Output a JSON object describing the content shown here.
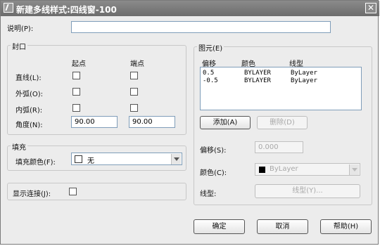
{
  "window": {
    "title": "新建多线样式:四线窗-100",
    "close_glyph": "✕"
  },
  "description": {
    "label": "说明(P):",
    "value": ""
  },
  "caps": {
    "group_title": "封口",
    "col_start": "起点",
    "col_end": "端点",
    "line_label": "直线(L):",
    "outer_arc_label": "外弧(O):",
    "inner_arc_label": "内弧(R):",
    "angle_label": "角度(N):",
    "angle_start": "90.00",
    "angle_end": "90.00",
    "line_start_checked": false,
    "line_end_checked": false,
    "outer_arc_start_checked": false,
    "outer_arc_end_checked": false,
    "inner_arc_start_checked": false,
    "inner_arc_end_checked": false
  },
  "fill": {
    "group_title": "填充",
    "label": "填充颜色(F):",
    "value": "无",
    "swatch_color": "#ffffff"
  },
  "joints": {
    "label": "显示连接(J):",
    "checked": false
  },
  "elements": {
    "group_title": "图元(E)",
    "headers": {
      "offset": "偏移",
      "color": "颜色",
      "linetype": "线型"
    },
    "rows": [
      {
        "offset": "0.5",
        "color": "BYLAYER",
        "linetype": "ByLayer"
      },
      {
        "offset": "-0.5",
        "color": "BYLAYER",
        "linetype": "ByLayer"
      }
    ],
    "add_button": "添加(A)",
    "delete_button": "删除(D)",
    "offset_label": "偏移(S):",
    "offset_value": "0.000",
    "color_label": "颜色(C):",
    "color_value": "ByLayer",
    "color_swatch": "#000000",
    "linetype_label": "线型:",
    "linetype_button": "线型(Y)..."
  },
  "buttons": {
    "ok": "确定",
    "cancel": "取消",
    "help": "帮助(H)"
  },
  "icons": {
    "app": "autocad-icon",
    "close": "close-icon",
    "dropdown": "chevron-down-icon"
  }
}
